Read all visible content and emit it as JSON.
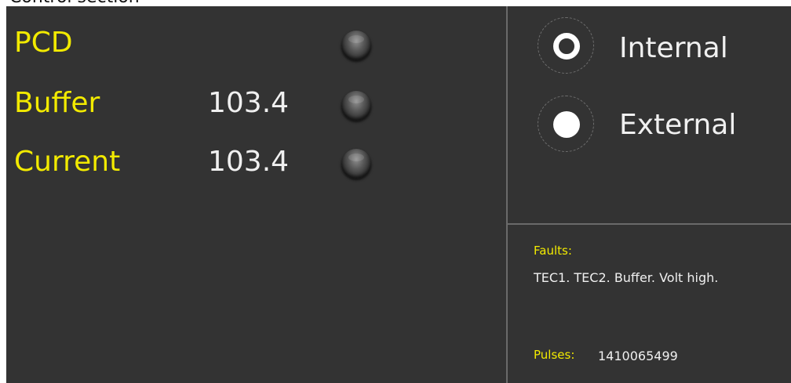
{
  "window": {
    "title": "Control section"
  },
  "status_rows": [
    {
      "label": "PCD",
      "value": "",
      "led_state": "off"
    },
    {
      "label": "Buffer",
      "value": "103.4",
      "led_state": "off"
    },
    {
      "label": "Current",
      "value": "103.4",
      "led_state": "off"
    }
  ],
  "mode": {
    "options": [
      {
        "label": "Internal",
        "style": "hollow"
      },
      {
        "label": "External",
        "style": "solid"
      }
    ]
  },
  "faults": {
    "label": "Faults:",
    "text": "TEC1. TEC2. Buffer. Volt high."
  },
  "pulses": {
    "label": "Pulses:",
    "value": "1410065499"
  },
  "colors": {
    "panel_background": "#333333",
    "label_yellow": "#f2ea00",
    "value_white": "#f0f0f0",
    "divider": "#6a6a6a"
  }
}
